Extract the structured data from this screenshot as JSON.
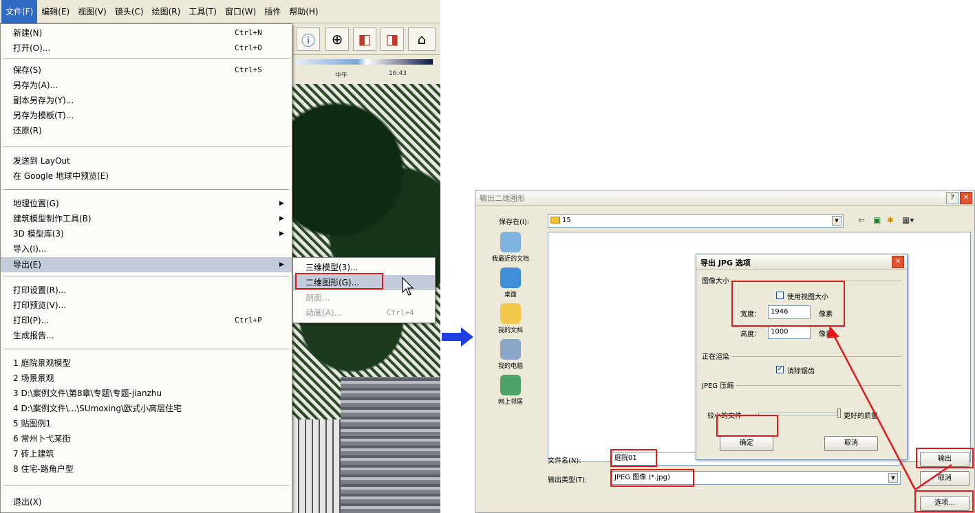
{
  "menubar": {
    "items": [
      "文件(F)",
      "编辑(E)",
      "视图(V)",
      "镜头(C)",
      "绘图(R)",
      "工具(T)",
      "窗口(W)",
      "插件",
      "帮助(H)"
    ],
    "active_index": 0
  },
  "file_menu": {
    "items": [
      {
        "label": "新建(N)",
        "shortcut": "Ctrl+N"
      },
      {
        "label": "打开(O)...",
        "shortcut": "Ctrl+O"
      },
      {
        "label": "保存(S)",
        "shortcut": "Ctrl+S"
      },
      {
        "label": "另存为(A)..."
      },
      {
        "label": "副本另存为(Y)..."
      },
      {
        "label": "另存为模板(T)..."
      },
      {
        "label": "还原(R)"
      },
      {
        "label": "发送到 LayOut"
      },
      {
        "label": "在 Google 地球中预览(E)"
      },
      {
        "label": "地理位置(G)",
        "arrow": "▶"
      },
      {
        "label": "建筑模型制作工具(B)",
        "arrow": "▶"
      },
      {
        "label": "3D 模型库(3)",
        "arrow": "▶"
      },
      {
        "label": "导入(I)..."
      },
      {
        "label": "导出(E)",
        "arrow": "▶"
      },
      {
        "label": "打印设置(R)..."
      },
      {
        "label": "打印预览(V)..."
      },
      {
        "label": "打印(P)...",
        "shortcut": "Ctrl+P"
      },
      {
        "label": "生成报告..."
      },
      {
        "label": "1 庭院景观模型"
      },
      {
        "label": "2 场景景观"
      },
      {
        "label": "3 D:\\案例文件\\第8章\\专题\\专题-jianzhu"
      },
      {
        "label": "4 D:\\案例文件\\...\\SUmoxing\\欧式小高层住宅"
      },
      {
        "label": "5 贴图例1"
      },
      {
        "label": "6 常州卜弋某街"
      },
      {
        "label": "7 砖上建筑"
      },
      {
        "label": "8 住宅-路角户型"
      },
      {
        "label": "退出(X)"
      }
    ]
  },
  "export_submenu": {
    "items": [
      {
        "label": "三维模型(3)...",
        "disabled": false
      },
      {
        "label": "二维图形(G)...",
        "disabled": false
      },
      {
        "label": "剖面...",
        "disabled": true
      },
      {
        "label": "动画(A)...",
        "shortcut": "Ctrl+4",
        "disabled": true
      }
    ]
  },
  "sun": {
    "left": "中午",
    "right": "16:43"
  },
  "dialog": {
    "title": "输出二维图形",
    "save_in_label": "保存在(I):",
    "save_in_value": "15",
    "places": [
      "我最近的文档",
      "桌面",
      "我的文档",
      "我的电脑",
      "网上邻居"
    ],
    "filename_label": "文件名(N):",
    "filename_value": "庭院01",
    "filetype_label": "输出类型(T):",
    "filetype_value": "JPEG 图像 (*.jpg)",
    "export_button": "输出",
    "cancel_button": "取消",
    "options_button": "选项..."
  },
  "options": {
    "title": "导出 JPG 选项",
    "image_size_group": "图像大小",
    "use_view_size": "使用视图大小",
    "width_label": "宽度：",
    "width_value": "1946",
    "height_label": "高度：",
    "height_value": "1000",
    "unit": "像素",
    "render_group": "正在渲染",
    "antialias": "消除锯齿",
    "compress_group": "JPEG 压缩",
    "smaller_file": "较小的文件",
    "better_quality": "更好的质量",
    "ok": "确定",
    "cancel": "取消"
  },
  "colors": {
    "highlight": "#c4cbdb",
    "annotation": "#e01818",
    "arrow": "#1f3fe0"
  }
}
